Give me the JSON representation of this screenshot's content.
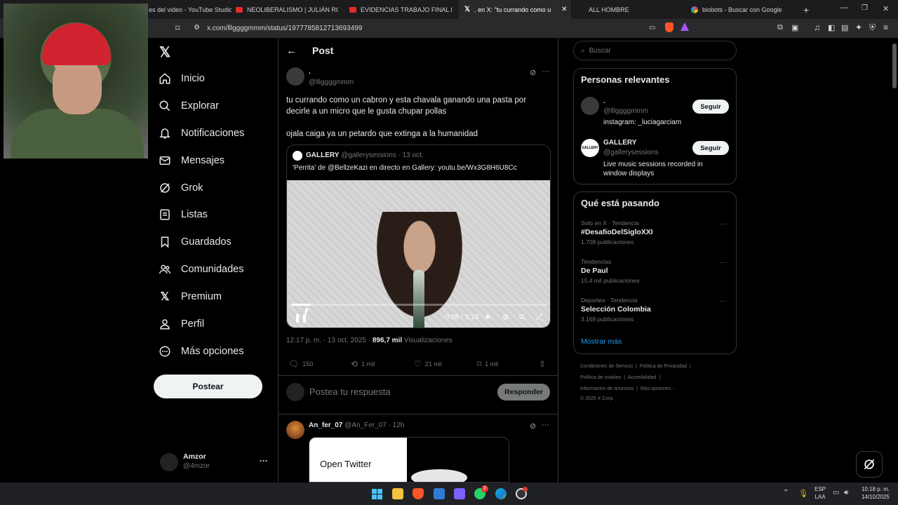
{
  "browser": {
    "tabs": [
      {
        "title": "es del video - YouTube Studio",
        "favicon": "youtube-icon",
        "active": false
      },
      {
        "title": "NEOLIBERALISMO | JULIÁN RODRÍGU",
        "favicon": "youtube-icon",
        "active": false
      },
      {
        "title": "EVIDENCIAS TRABAJO FINAL DE GR",
        "favicon": "youtube-icon",
        "active": false
      },
      {
        "title": ". en X: \"tu currando como u",
        "favicon": "x-icon",
        "active": true
      },
      {
        "title": "ALL HOMBRE",
        "favicon": "none",
        "active": false
      },
      {
        "title": "biobots - Buscar con Google",
        "favicon": "google-icon",
        "active": false
      }
    ],
    "url": "x.com/lllggggmmm/status/1977785812713693499"
  },
  "nav": {
    "items": [
      {
        "label": "Inicio",
        "icon": "home-icon"
      },
      {
        "label": "Explorar",
        "icon": "search-icon"
      },
      {
        "label": "Notificaciones",
        "icon": "bell-icon"
      },
      {
        "label": "Mensajes",
        "icon": "mail-icon"
      },
      {
        "label": "Grok",
        "icon": "grok-icon"
      },
      {
        "label": "Listas",
        "icon": "list-icon"
      },
      {
        "label": "Guardados",
        "icon": "bookmark-icon"
      },
      {
        "label": "Comunidades",
        "icon": "people-icon"
      },
      {
        "label": "Premium",
        "icon": "x-logo-icon"
      },
      {
        "label": "Perfil",
        "icon": "person-icon"
      },
      {
        "label": "Más opciones",
        "icon": "more-circle-icon"
      }
    ],
    "post_button": "Postear",
    "account": {
      "name": "Amzor",
      "handle": "@4mzor"
    }
  },
  "post": {
    "header": "Post",
    "author_name": ".",
    "author_handle": "@lllggggmmm",
    "text_line1": "tu currando como un cabron y esta chavala ganando una pasta por",
    "text_line2": "decirle a un micro que le gusta chupar pollas",
    "text_line3": "ojala caiga ya un petardo que extinga a la humanidad",
    "quote": {
      "name": "GALLERY",
      "handle": "@gallerysessions",
      "date": "· 13 oct.",
      "text": "'Perrita' de @BellzeKazi en directo en Gallery: youtu.be/Wx3G8H6U8Cc",
      "video_time": "0:06 / 1:19",
      "progress": 0.076
    },
    "timestamp": "12:17 p. m. · 13 oct. 2025 ·",
    "views_count": "896,7 mil",
    "views_label": "Visualizaciones",
    "actions": {
      "replies": "150",
      "reposts": "1 mil",
      "likes": "21 mil",
      "bookmarks": "1 mil"
    },
    "reply_placeholder": "Postea tu respuesta",
    "reply_button": "Responder"
  },
  "reply": {
    "name": "An_fer_07",
    "handle": "@An_Fer_07",
    "age": "· 12h",
    "image_text": "Open Twitter"
  },
  "sidebar": {
    "search_placeholder": "Buscar",
    "relevant_title": "Personas relevantes",
    "people": [
      {
        "name": ".",
        "handle": "@lllggggmmm",
        "bio": "instagram: _luciagarciam",
        "button": "Seguir"
      },
      {
        "name": "GALLERY",
        "handle": "@gallerysessions",
        "bio_line1": "Live music sessions recorded in",
        "bio_line2": "window displays",
        "button": "Seguir"
      }
    ],
    "trends_title": "Qué está pasando",
    "trends": [
      {
        "context": "Solo en X · Tendencia",
        "name": "#DesafioDelSigloXXI",
        "count": "1.708 publicaciones"
      },
      {
        "context": "Tendencias",
        "name": "De Paul",
        "count": "15,4 mil publicaciones"
      },
      {
        "context": "Deportes · Tendencia",
        "name": "Selección Colombia",
        "count": "3.169 publicaciones"
      }
    ],
    "show_more": "Mostrar más",
    "footer": {
      "l1a": "Condiciones de Servicio",
      "l1b": "Política de Privacidad",
      "l2a": "Política de cookies",
      "l2b": "Accesibilidad",
      "l3a": "Información de anuncios",
      "l3b": "Más opciones ···",
      "l4": "© 2025 X Corp."
    }
  },
  "taskbar": {
    "lang1": "ESP",
    "lang2": "LAA",
    "time": "10:18 p. m.",
    "date": "14/10/2025",
    "whatsapp_badge": "2"
  },
  "colors": {
    "accent": "#1d9bf0",
    "background": "#000000",
    "border": "#2f3336",
    "muted": "#71767b"
  }
}
